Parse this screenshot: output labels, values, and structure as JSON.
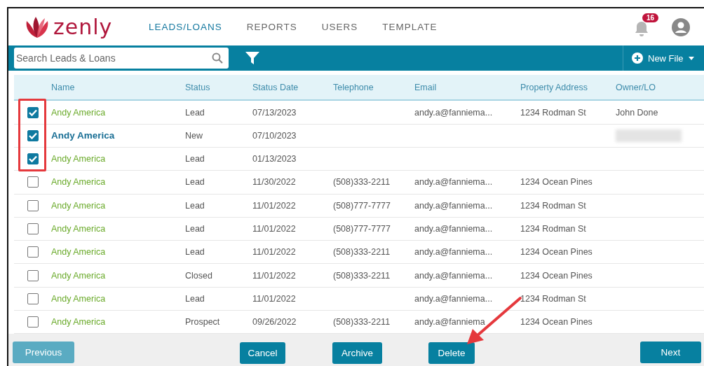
{
  "logo": {
    "text": "zenly"
  },
  "nav": [
    {
      "label": "LEADS/LOANS",
      "selected": true
    },
    {
      "label": "REPORTS",
      "selected": false
    },
    {
      "label": "USERS",
      "selected": false
    },
    {
      "label": "TEMPLATE",
      "selected": false
    }
  ],
  "notifications": {
    "count": "16"
  },
  "search": {
    "placeholder": "Search Leads & Loans"
  },
  "new_file": {
    "label": "New File"
  },
  "table": {
    "columns": [
      "Name",
      "Status",
      "Status Date",
      "Telephone",
      "Email",
      "Property Address",
      "Owner/LO"
    ],
    "rows": [
      {
        "checked": true,
        "hovered": false,
        "redacted": false,
        "cells": [
          "Andy America",
          "Lead",
          "07/13/2023",
          "",
          "andy.a@fanniema...",
          "1234 Rodman St",
          "John Done"
        ]
      },
      {
        "checked": true,
        "hovered": true,
        "redacted": true,
        "cells": [
          "Andy America",
          "New",
          "07/10/2023",
          "",
          "",
          "",
          ""
        ]
      },
      {
        "checked": true,
        "hovered": false,
        "redacted": false,
        "cells": [
          "Andy America",
          "Lead",
          "01/13/2023",
          "",
          "",
          "",
          ""
        ]
      },
      {
        "checked": false,
        "hovered": false,
        "redacted": false,
        "cells": [
          "Andy America",
          "Lead",
          "11/30/2022",
          "(508)333-2211",
          "andy.a@fanniema...",
          "1234 Ocean Pines",
          ""
        ]
      },
      {
        "checked": false,
        "hovered": false,
        "redacted": false,
        "cells": [
          "Andy America",
          "Lead",
          "11/01/2022",
          "(508)777-7777",
          "andy.a@fanniema...",
          "1234 Rodman St",
          ""
        ]
      },
      {
        "checked": false,
        "hovered": false,
        "redacted": false,
        "cells": [
          "Andy America",
          "Lead",
          "11/01/2022",
          "(508)777-7777",
          "andy.a@fanniema...",
          "1234 Rodman St",
          ""
        ]
      },
      {
        "checked": false,
        "hovered": false,
        "redacted": false,
        "cells": [
          "Andy America",
          "Lead",
          "11/01/2022",
          "(508)333-2211",
          "andy.a@fanniema...",
          "1234 Ocean Pines",
          ""
        ]
      },
      {
        "checked": false,
        "hovered": false,
        "redacted": false,
        "cells": [
          "Andy America",
          "Closed",
          "11/01/2022",
          "(508)333-2211",
          "andy.a@fanniema...",
          "1234 Ocean Pines",
          ""
        ]
      },
      {
        "checked": false,
        "hovered": false,
        "redacted": false,
        "cells": [
          "Andy America",
          "Lead",
          "11/01/2022",
          "",
          "andy.a@fanniema...",
          "1234 Rodman St",
          ""
        ]
      },
      {
        "checked": false,
        "hovered": false,
        "redacted": false,
        "cells": [
          "Andy America",
          "Prospect",
          "09/26/2022",
          "(508)333-2211",
          "andy.a@fanniema",
          "1234 Ocean Pines",
          ""
        ]
      }
    ]
  },
  "footer": [
    {
      "label": "Previous",
      "disabled": true
    },
    {
      "label": "Cancel",
      "disabled": false
    },
    {
      "label": "Archive",
      "disabled": false
    },
    {
      "label": "Delete",
      "disabled": false
    },
    {
      "label": "Next",
      "disabled": false
    }
  ],
  "annotations": {
    "highlight_box": true,
    "arrow": true
  }
}
